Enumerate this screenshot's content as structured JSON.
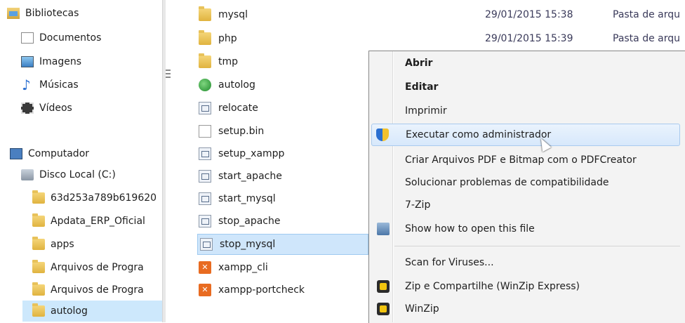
{
  "nav": {
    "items": [
      {
        "label": "Bibliotecas",
        "icon": "libraries-icon"
      },
      {
        "label": "Documentos",
        "icon": "documents-icon"
      },
      {
        "label": "Imagens",
        "icon": "pictures-icon"
      },
      {
        "label": "Músicas",
        "icon": "music-icon"
      },
      {
        "label": "Vídeos",
        "icon": "videos-icon"
      },
      {
        "label": "Computador",
        "icon": "computer-icon"
      },
      {
        "label": "Disco Local (C:)",
        "icon": "local-disk-icon"
      },
      {
        "label": "63d253a789b619620",
        "icon": "folder-icon"
      },
      {
        "label": "Apdata_ERP_Oficial",
        "icon": "folder-icon"
      },
      {
        "label": "apps",
        "icon": "folder-icon"
      },
      {
        "label": "Arquivos de Progra",
        "icon": "folder-icon"
      },
      {
        "label": "Arquivos de Progra",
        "icon": "folder-icon"
      },
      {
        "label": "autolog",
        "icon": "folder-icon",
        "selected": true
      }
    ]
  },
  "files": [
    {
      "name": "mysql",
      "date": "29/01/2015 15:38",
      "type": "Pasta de arqu",
      "icon": "folder-icon"
    },
    {
      "name": "php",
      "date": "29/01/2015 15:39",
      "type": "Pasta de arqu",
      "icon": "folder-icon"
    },
    {
      "name": "tmp",
      "date": "",
      "type": "",
      "icon": "folder-icon"
    },
    {
      "name": "autolog",
      "date": "",
      "type": "",
      "icon": "globe-app-icon"
    },
    {
      "name": "relocate",
      "date": "",
      "type": "",
      "icon": "script-icon"
    },
    {
      "name": "setup.bin",
      "date": "",
      "type": "",
      "icon": "blank-file-icon"
    },
    {
      "name": "setup_xampp",
      "date": "",
      "type": "",
      "icon": "script-icon"
    },
    {
      "name": "start_apache",
      "date": "",
      "type": "",
      "icon": "script-icon"
    },
    {
      "name": "start_mysql",
      "date": "",
      "type": "",
      "icon": "script-icon"
    },
    {
      "name": "stop_apache",
      "date": "",
      "type": "",
      "icon": "script-icon"
    },
    {
      "name": "stop_mysql",
      "date": "",
      "type": "",
      "icon": "script-icon",
      "selected": true
    },
    {
      "name": "xampp_cli",
      "date": "",
      "type": "",
      "icon": "xampp-icon"
    },
    {
      "name": "xampp-portcheck",
      "date": "",
      "type": "",
      "icon": "xampp-icon"
    }
  ],
  "context_menu": {
    "items": [
      {
        "label": "Abrir",
        "bold": true
      },
      {
        "label": "Editar",
        "bold": true
      },
      {
        "label": "Imprimir",
        "bold": false
      },
      {
        "label": "Executar como administrador",
        "icon": "uac-shield-icon",
        "hover": true
      },
      {
        "label": "Criar Arquivos PDF e Bitmap com o PDFCreator"
      },
      {
        "label": "Solucionar problemas de compatibilidade"
      },
      {
        "label": "7-Zip"
      },
      {
        "label": "Show how to open this file",
        "icon": "file-info-icon"
      },
      {
        "label": "Scan for Viruses..."
      },
      {
        "label": "Zip e Compartilhe (WinZip Express)",
        "icon": "winzip-icon"
      },
      {
        "label": "WinZip",
        "icon": "winzip-icon"
      }
    ]
  },
  "colors": {
    "selection": "#cde8fc",
    "menu_bg": "#f3f3f3",
    "hover_border": "#a9caee"
  }
}
